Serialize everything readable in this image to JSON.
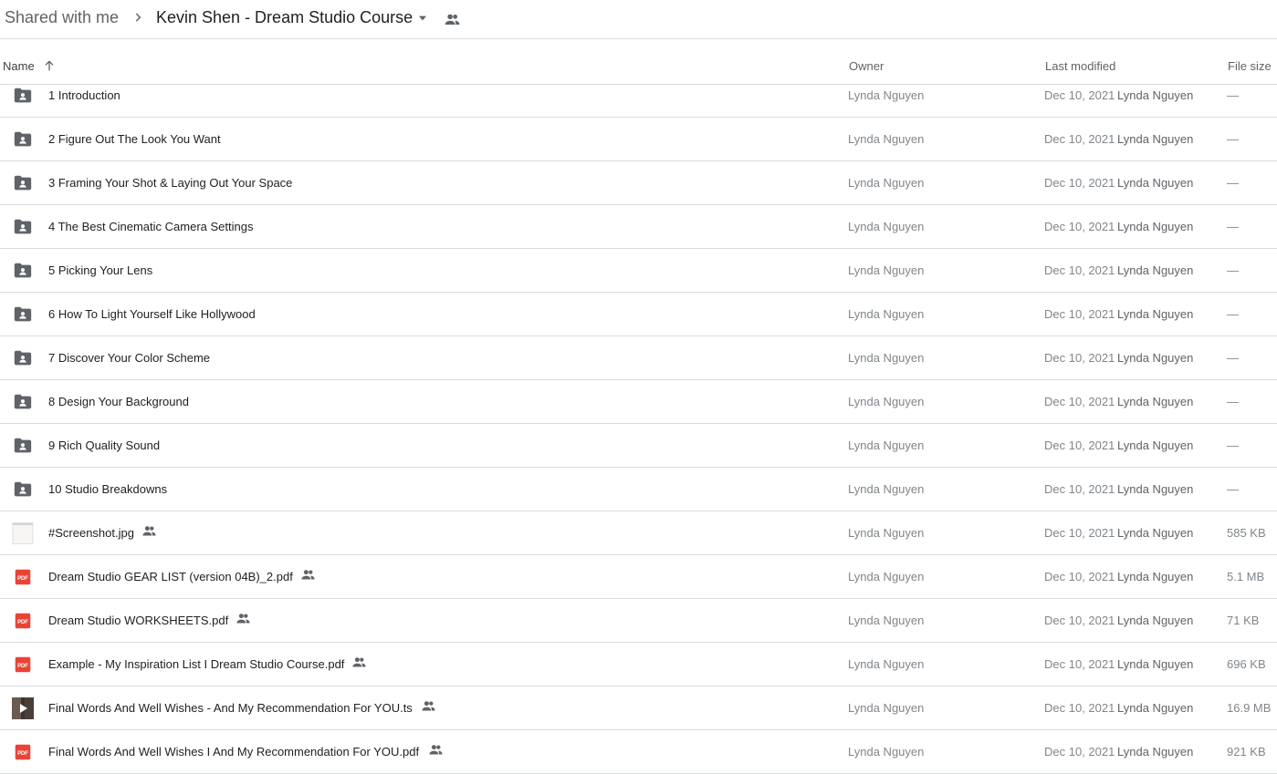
{
  "breadcrumb": {
    "root": "Shared with me",
    "current": "Kevin Shen - Dream Studio Course"
  },
  "columns": {
    "name": "Name",
    "owner": "Owner",
    "last_modified": "Last modified",
    "file_size": "File size"
  },
  "files": [
    {
      "name": "1 Introduction",
      "type": "folder",
      "shared": false,
      "owner": "Lynda Nguyen",
      "date": "Dec 10, 2021",
      "modified_by": "Lynda Nguyen",
      "size": "—"
    },
    {
      "name": "2 Figure Out The Look You Want",
      "type": "folder",
      "shared": false,
      "owner": "Lynda Nguyen",
      "date": "Dec 10, 2021",
      "modified_by": "Lynda Nguyen",
      "size": "—"
    },
    {
      "name": "3 Framing Your Shot & Laying Out Your Space",
      "type": "folder",
      "shared": false,
      "owner": "Lynda Nguyen",
      "date": "Dec 10, 2021",
      "modified_by": "Lynda Nguyen",
      "size": "—"
    },
    {
      "name": "4 The Best Cinematic Camera Settings",
      "type": "folder",
      "shared": false,
      "owner": "Lynda Nguyen",
      "date": "Dec 10, 2021",
      "modified_by": "Lynda Nguyen",
      "size": "—"
    },
    {
      "name": "5 Picking Your Lens",
      "type": "folder",
      "shared": false,
      "owner": "Lynda Nguyen",
      "date": "Dec 10, 2021",
      "modified_by": "Lynda Nguyen",
      "size": "—"
    },
    {
      "name": "6 How To Light Yourself Like Hollywood",
      "type": "folder",
      "shared": false,
      "owner": "Lynda Nguyen",
      "date": "Dec 10, 2021",
      "modified_by": "Lynda Nguyen",
      "size": "—"
    },
    {
      "name": "7 Discover Your Color Scheme",
      "type": "folder",
      "shared": false,
      "owner": "Lynda Nguyen",
      "date": "Dec 10, 2021",
      "modified_by": "Lynda Nguyen",
      "size": "—"
    },
    {
      "name": "8 Design Your Background",
      "type": "folder",
      "shared": false,
      "owner": "Lynda Nguyen",
      "date": "Dec 10, 2021",
      "modified_by": "Lynda Nguyen",
      "size": "—"
    },
    {
      "name": "9 Rich Quality Sound",
      "type": "folder",
      "shared": false,
      "owner": "Lynda Nguyen",
      "date": "Dec 10, 2021",
      "modified_by": "Lynda Nguyen",
      "size": "—"
    },
    {
      "name": "10 Studio Breakdowns",
      "type": "folder",
      "shared": false,
      "owner": "Lynda Nguyen",
      "date": "Dec 10, 2021",
      "modified_by": "Lynda Nguyen",
      "size": "—"
    },
    {
      "name": "#Screenshot.jpg",
      "type": "image",
      "shared": true,
      "owner": "Lynda Nguyen",
      "date": "Dec 10, 2021",
      "modified_by": "Lynda Nguyen",
      "size": "585 KB"
    },
    {
      "name": "Dream Studio GEAR LIST (version 04B)_2.pdf",
      "type": "pdf",
      "shared": true,
      "owner": "Lynda Nguyen",
      "date": "Dec 10, 2021",
      "modified_by": "Lynda Nguyen",
      "size": "5.1 MB"
    },
    {
      "name": "Dream Studio WORKSHEETS.pdf",
      "type": "pdf",
      "shared": true,
      "owner": "Lynda Nguyen",
      "date": "Dec 10, 2021",
      "modified_by": "Lynda Nguyen",
      "size": "71 KB"
    },
    {
      "name": "Example - My Inspiration List I Dream Studio Course.pdf",
      "type": "pdf",
      "shared": true,
      "owner": "Lynda Nguyen",
      "date": "Dec 10, 2021",
      "modified_by": "Lynda Nguyen",
      "size": "696 KB"
    },
    {
      "name": "Final Words And Well Wishes - And My Recommendation For YOU.ts",
      "type": "video",
      "shared": true,
      "owner": "Lynda Nguyen",
      "date": "Dec 10, 2021",
      "modified_by": "Lynda Nguyen",
      "size": "16.9 MB"
    },
    {
      "name": "Final Words And Well Wishes I And My Recommendation For YOU.pdf",
      "type": "pdf",
      "shared": true,
      "owner": "Lynda Nguyen",
      "date": "Dec 10, 2021",
      "modified_by": "Lynda Nguyen",
      "size": "921 KB"
    }
  ],
  "icons": {
    "breadcrumb_separator": "chevron-right-icon",
    "breadcrumb_menu": "caret-down-icon",
    "shared_folder": "people-icon",
    "sort": "arrow-up-icon",
    "folder": "shared-folder-icon",
    "pdf": "pdf-icon",
    "image": "image-thumbnail-icon",
    "video": "video-thumbnail-icon"
  },
  "colors": {
    "pdf_red": "#ea4335",
    "folder_gray": "#5f6368",
    "divider": "#dadce0",
    "text_secondary": "#80868b"
  }
}
